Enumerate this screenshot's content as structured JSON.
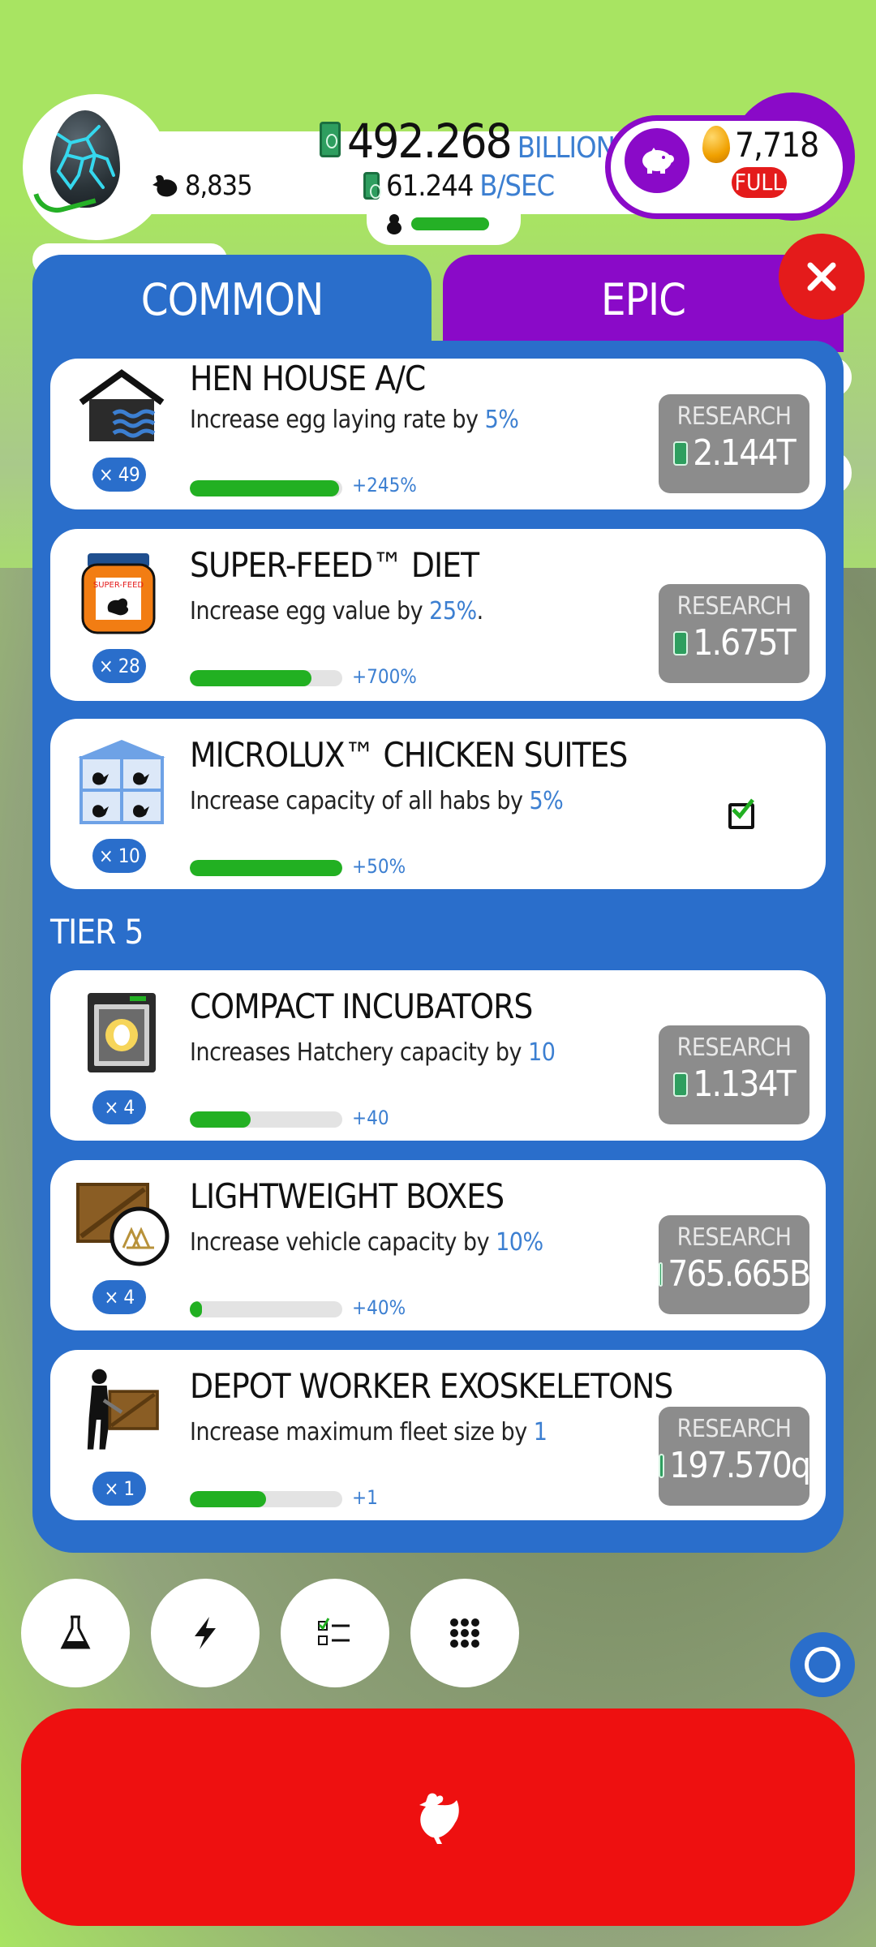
{
  "header": {
    "chicken_count": "8,835",
    "money_value": "492.268",
    "money_unit": "BILLION",
    "rate_value": "61.244",
    "rate_unit": "B/SEC",
    "golden_eggs": "7,718",
    "piggy_status": "FULL",
    "progress_fraction": 0.62
  },
  "tabs": {
    "common": "COMMON",
    "epic": "EPIC"
  },
  "research_label": "RESEARCH",
  "items": [
    {
      "title": "HEN HOUSE A/C",
      "desc_pre": "Increase egg laying rate by ",
      "desc_val": "5%",
      "desc_post": "",
      "level": "× 49",
      "bonus": "+245%",
      "progress": 0.98,
      "price": "2.144T",
      "icon": "hen-house-ac-icon"
    },
    {
      "title": "SUPER-FEED™ DIET",
      "desc_pre": "Increase egg value by ",
      "desc_val": "25%",
      "desc_post": ".",
      "level": "× 28",
      "bonus": "+700%",
      "progress": 0.8,
      "price": "1.675T",
      "icon": "super-feed-jar-icon"
    },
    {
      "title": "MICROLUX™ CHICKEN SUITES",
      "desc_pre": "Increase capacity of all habs by ",
      "desc_val": "5%",
      "desc_post": "",
      "level": "× 10",
      "bonus": "+50%",
      "progress": 1.0,
      "price": "",
      "icon": "chicken-suites-icon"
    },
    {
      "title": "COMPACT INCUBATORS",
      "desc_pre": "Increases Hatchery capacity by ",
      "desc_val": "10",
      "desc_post": "",
      "level": "× 4",
      "bonus": "+40",
      "progress": 0.4,
      "price": "1.134T",
      "icon": "incubator-icon"
    },
    {
      "title": "LIGHTWEIGHT BOXES",
      "desc_pre": "Increase vehicle capacity by ",
      "desc_val": "10%",
      "desc_post": "",
      "level": "× 4",
      "bonus": "+40%",
      "progress": 0.08,
      "price": "765.665B",
      "icon": "lightweight-box-icon"
    },
    {
      "title": "DEPOT WORKER EXOSKELETONS",
      "desc_pre": "Increase maximum fleet size by ",
      "desc_val": "1",
      "desc_post": "",
      "level": "× 1",
      "bonus": "+1",
      "progress": 0.5,
      "price": "197.570q",
      "icon": "exoskeleton-worker-icon"
    }
  ],
  "tier_label": "TIER 5",
  "colors": {
    "panel_blue": "#2a6ecb",
    "epic_purple": "#8a0ac8",
    "progress_green": "#22b022",
    "accent_blue": "#3c7fd1",
    "close_red": "#e41b1b",
    "hatch_red": "#ee1010",
    "background_green": "#a8e462"
  },
  "bottom_buttons": [
    "research-flask-icon",
    "boost-lightning-icon",
    "missions-checklist-icon",
    "menu-grid-icon"
  ]
}
